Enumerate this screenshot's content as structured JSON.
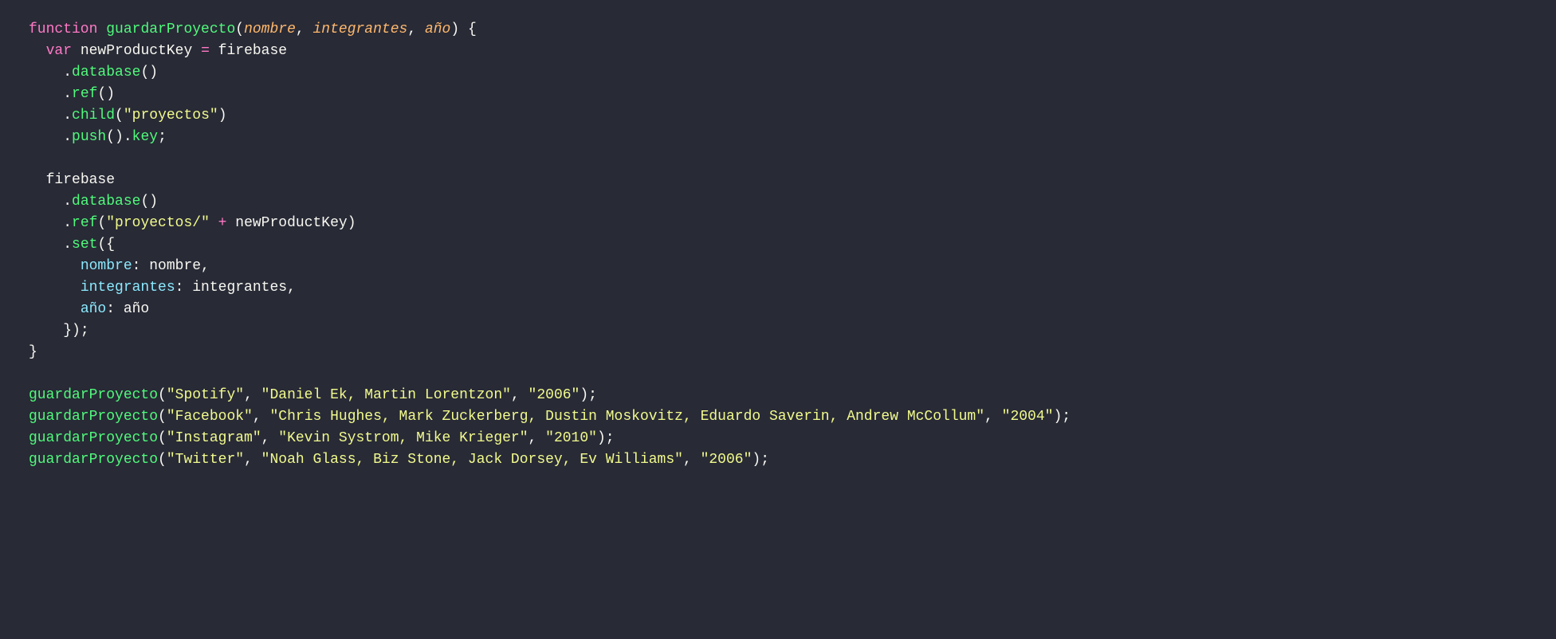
{
  "code": {
    "line1": {
      "kw_function": "function",
      "fn_name": "guardarProyecto",
      "open_paren": "(",
      "param1": "nombre",
      "comma1": ", ",
      "param2": "integrantes",
      "comma2": ", ",
      "param3": "año",
      "close_paren": ")",
      "brace": " {"
    },
    "line2": {
      "indent": "  ",
      "kw_var": "var",
      "space": " ",
      "ident": "newProductKey",
      "eq": " = ",
      "firebase": "firebase"
    },
    "line3": {
      "indent": "    ",
      "dot": ".",
      "method": "database",
      "parens": "()"
    },
    "line4": {
      "indent": "    ",
      "dot": ".",
      "method": "ref",
      "parens": "()"
    },
    "line5": {
      "indent": "    ",
      "dot": ".",
      "method": "child",
      "open": "(",
      "str": "\"proyectos\"",
      "close": ")"
    },
    "line6": {
      "indent": "    ",
      "dot": ".",
      "method": "push",
      "parens": "()",
      "dot2": ".",
      "prop": "key",
      "semi": ";"
    },
    "line7": {
      "blank": " "
    },
    "line8": {
      "indent": "  ",
      "firebase": "firebase"
    },
    "line9": {
      "indent": "    ",
      "dot": ".",
      "method": "database",
      "parens": "()"
    },
    "line10": {
      "indent": "    ",
      "dot": ".",
      "method": "ref",
      "open": "(",
      "str": "\"proyectos/\"",
      "plus": " + ",
      "ident": "newProductKey",
      "close": ")"
    },
    "line11": {
      "indent": "    ",
      "dot": ".",
      "method": "set",
      "open": "({"
    },
    "line12": {
      "indent": "      ",
      "attr": "nombre",
      "colon": ": ",
      "ident": "nombre",
      "comma": ","
    },
    "line13": {
      "indent": "      ",
      "attr": "integrantes",
      "colon": ": ",
      "ident": "integrantes",
      "comma": ","
    },
    "line14": {
      "indent": "      ",
      "attr": "año",
      "colon": ": ",
      "ident": "año"
    },
    "line15": {
      "indent": "    ",
      "close": "});"
    },
    "line16": {
      "close": "}"
    },
    "line17": {
      "blank": " "
    },
    "call1": {
      "fn": "guardarProyecto",
      "open": "(",
      "arg1": "\"Spotify\"",
      "c1": ", ",
      "arg2": "\"Daniel Ek, Martin Lorentzon\"",
      "c2": ", ",
      "arg3": "\"2006\"",
      "close": ");"
    },
    "call2": {
      "fn": "guardarProyecto",
      "open": "(",
      "arg1": "\"Facebook\"",
      "c1": ", ",
      "arg2": "\"Chris Hughes, Mark Zuckerberg, Dustin Moskovitz, Eduardo Saverin, Andrew McCollum\"",
      "c2": ", ",
      "arg3": "\"2004\"",
      "close": ");"
    },
    "call3": {
      "fn": "guardarProyecto",
      "open": "(",
      "arg1": "\"Instagram\"",
      "c1": ", ",
      "arg2": "\"Kevin Systrom, Mike Krieger\"",
      "c2": ", ",
      "arg3": "\"2010\"",
      "close": ");"
    },
    "call4": {
      "fn": "guardarProyecto",
      "open": "(",
      "arg1": "\"Twitter\"",
      "c1": ", ",
      "arg2": "\"Noah Glass, Biz Stone, Jack Dorsey, Ev Williams\"",
      "c2": ", ",
      "arg3": "\"2006\"",
      "close": ");"
    }
  }
}
